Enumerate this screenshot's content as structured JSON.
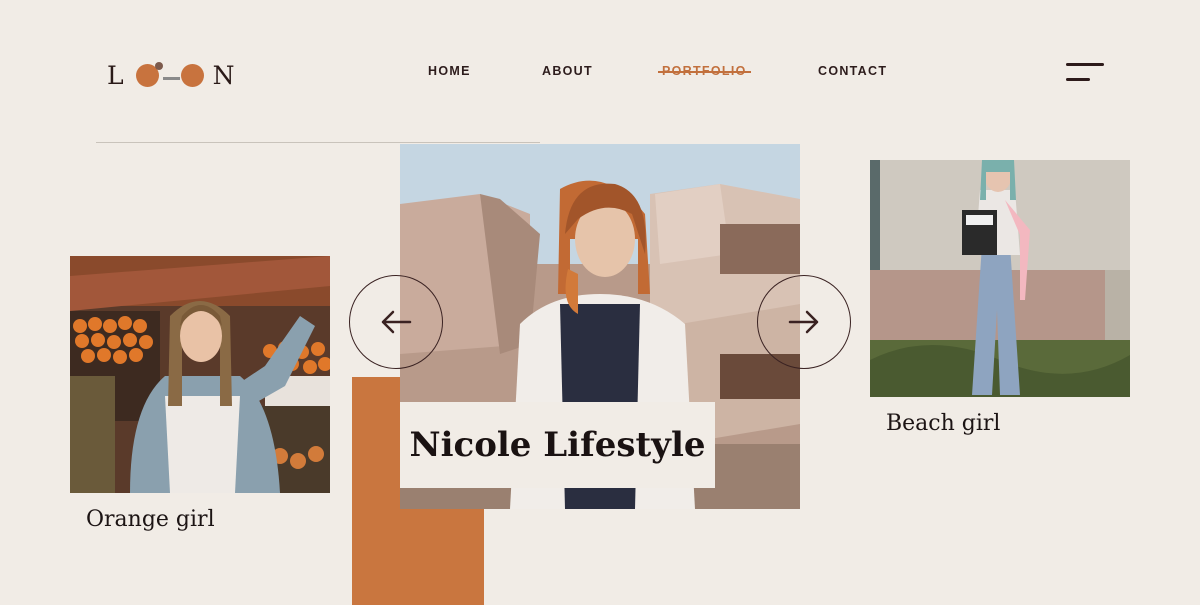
{
  "logo": {
    "first_letter": "L",
    "last_letter": "N"
  },
  "nav": [
    {
      "label": "HOME"
    },
    {
      "label": "ABOUT"
    },
    {
      "label": "PORTFOLIO",
      "active": true
    },
    {
      "label": "CONTACT"
    }
  ],
  "slider": {
    "prev": {
      "caption": "Orange girl"
    },
    "current": {
      "title": "Nicole Lifestyle"
    },
    "next": {
      "caption": "Beach girl"
    }
  },
  "icons": {
    "menu": "hamburger-icon",
    "prev": "arrow-left-icon",
    "next": "arrow-right-icon"
  },
  "colors": {
    "background": "#f1ece6",
    "accent": "#c9763f",
    "text": "#1a1212"
  }
}
